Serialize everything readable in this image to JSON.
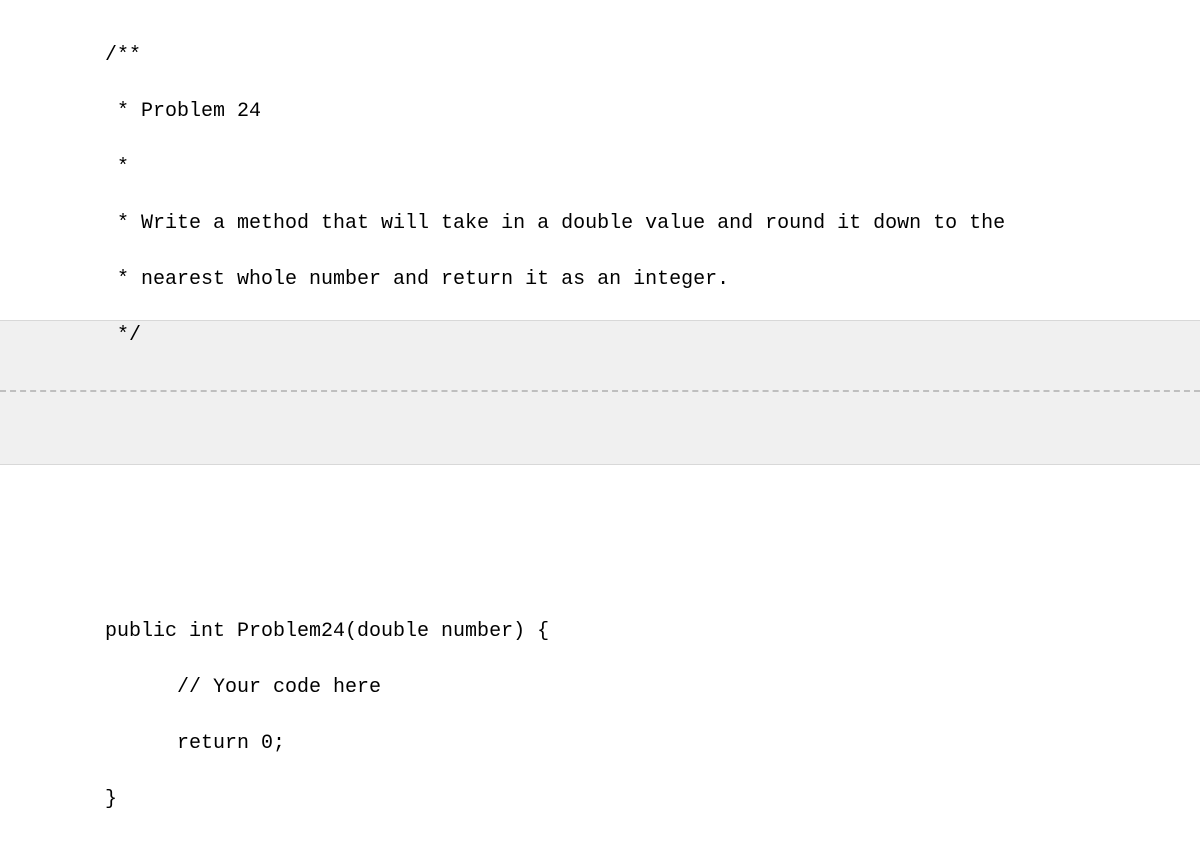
{
  "comment": {
    "l1": "/**",
    "l2": " * Problem 24",
    "l3": " *",
    "l4": " * Write a method that will take in a double value and round it down to the",
    "l5": " * nearest whole number and return it as an integer.",
    "l6": " */"
  },
  "code": {
    "l1": "public int Problem24(double number) {",
    "l2": "      // Your code here",
    "l3": "      return 0;",
    "l4": "}"
  }
}
